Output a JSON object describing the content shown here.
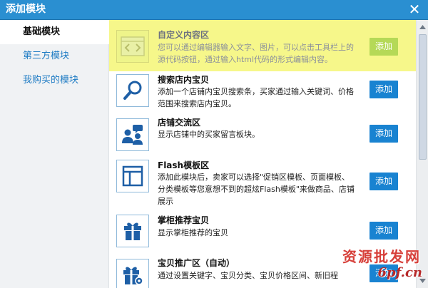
{
  "dialog": {
    "title": "添加模块",
    "close_glyph": "✕"
  },
  "sidebar": {
    "items": [
      {
        "label": "基础模块",
        "active": true
      },
      {
        "label": "第三方模块",
        "active": false
      },
      {
        "label": "我购买的模块",
        "active": false
      }
    ]
  },
  "modules": [
    {
      "icon": "code-icon",
      "title": "自定义内容区",
      "desc": "您可以通过编辑器输入文字、图片，可以点击工具栏上的源代码按钮，通过输入html代码的形式编辑内容。",
      "button": "添加",
      "highlighted": true
    },
    {
      "icon": "magnifier-icon",
      "title": "搜索店内宝贝",
      "desc": "添加一个店铺内宝贝搜索条，买家通过输入关键词、价格范围来搜索店内宝贝。",
      "button": "添加"
    },
    {
      "icon": "people-chat-icon",
      "title": "店铺交流区",
      "desc": "显示店铺中的买家留言板块。",
      "button": "添加"
    },
    {
      "icon": "layout-icon",
      "title": "Flash模板区",
      "desc": "添加此模块后，卖家可以选择\"促销区模板、页面模板、分类模板等您意想不到的超炫Flash模板\"来做商品、店铺展示",
      "button": "添加"
    },
    {
      "icon": "gift-icon",
      "title": "掌柜推荐宝贝",
      "desc": "显示掌柜推荐的宝贝",
      "button": "添加"
    },
    {
      "icon": "gift-gear-icon",
      "title": "宝贝推广区（自动）",
      "desc": "通过设置关键字、宝贝分类、宝贝价格区间、新旧程",
      "button": "添加"
    }
  ],
  "colors": {
    "titlebar": "#2a8fd1",
    "button": "#1983d1",
    "highlight": "#f6f78a",
    "highlight_button": "#b5d957",
    "link": "#1f7cc4"
  },
  "watermark": {
    "line1": "资源批发网",
    "line2": "6pf.cn"
  }
}
